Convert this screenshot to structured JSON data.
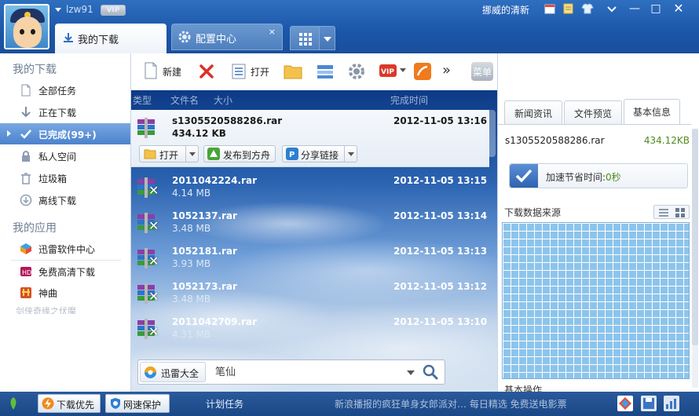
{
  "user": {
    "name": "lzw91",
    "vip": "VIP"
  },
  "main_tabs": [
    {
      "label": "我的下载",
      "icon": "download-arrow-icon"
    },
    {
      "label": "配置中心",
      "icon": "gear-icon",
      "close": "×"
    }
  ],
  "title_bar": {
    "brand_text": "挪威的清新",
    "minimize": "—",
    "maximize": "□",
    "close": "✕"
  },
  "sidebar": {
    "section_downloads": "我的下载",
    "items": [
      {
        "label": "全部任务",
        "icon": "file-icon"
      },
      {
        "label": "正在下载",
        "icon": "down-arrow-icon"
      },
      {
        "label": "已完成(99+)",
        "icon": "check-icon",
        "active": true
      },
      {
        "label": "私人空间",
        "icon": "lock-icon"
      },
      {
        "label": "垃圾箱",
        "icon": "trash-icon"
      },
      {
        "label": "离线下载",
        "icon": "offline-download-icon"
      }
    ],
    "section_apps": "我的应用",
    "apps": [
      {
        "label": "迅雷软件中心",
        "icon": "software-center-icon"
      },
      {
        "label": "免费高清下载",
        "icon": "hd-icon"
      },
      {
        "label": "神曲",
        "icon": "music-icon"
      }
    ],
    "faded_item": "剑侠奇缘之伏魔"
  },
  "toolbar": {
    "new": "新建",
    "open": "打开",
    "menu": "菜单",
    "more": "»"
  },
  "list": {
    "headers": {
      "type": "类型",
      "name": "文件名",
      "size": "大小",
      "time": "完成时间"
    },
    "selected": {
      "name": "s1305520588286.rar",
      "size": "434.12 KB",
      "time": "2012-11-05 13:16"
    },
    "actions": {
      "open": "打开",
      "publish": "发布到方舟",
      "share": "分享链接"
    },
    "rows": [
      {
        "name": "2011042224.rar",
        "size": "4.14 MB",
        "time": "2012-11-05 13:15"
      },
      {
        "name": "1052137.rar",
        "size": "3.48 MB",
        "time": "2012-11-05 13:14"
      },
      {
        "name": "1052181.rar",
        "size": "3.93 MB",
        "time": "2012-11-05 13:13"
      },
      {
        "name": "1052173.rar",
        "size": "3.48 MB",
        "time": "2012-11-05 13:12"
      },
      {
        "name": "2011042709.rar",
        "size": "4.31 MB",
        "time": "2012-11-05 13:10"
      }
    ]
  },
  "search": {
    "engine": "迅雷大全",
    "value": "笔仙"
  },
  "right_panel": {
    "tabs": [
      "新闻资讯",
      "文件预览",
      "基本信息"
    ],
    "file_name": "s1305520588286.rar",
    "file_size": "434.12KB",
    "speed_label": "加速节省时间:",
    "speed_value": "0秒",
    "source_title": "下载数据来源",
    "ops_title": "基本操作"
  },
  "status_bar": {
    "priority": "下载优先",
    "protect": "网速保护",
    "task": "计划任务",
    "ticker": "新浪播报的疯狂单身女郎派对… 每日精选 免费送电影票"
  },
  "colors": {
    "accent": "#1b56a8",
    "active_item": "#4b82cc",
    "success": "#4e8b1e"
  }
}
